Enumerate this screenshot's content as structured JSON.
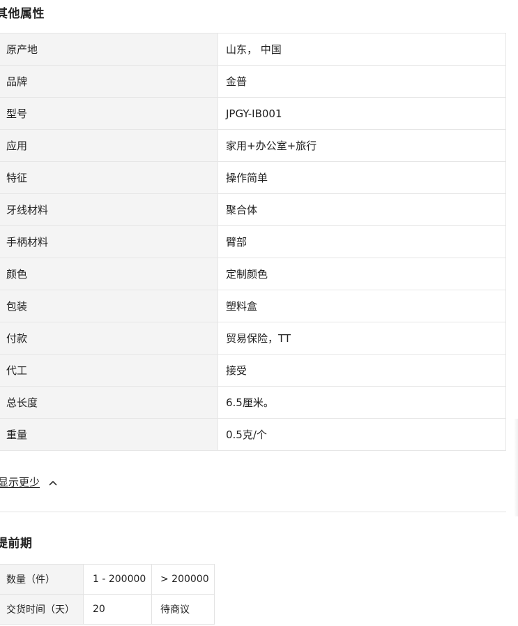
{
  "other_attributes": {
    "title": "其他属性",
    "rows": [
      {
        "key": "原产地",
        "value": "山东， 中国"
      },
      {
        "key": "品牌",
        "value": "金普"
      },
      {
        "key": "型号",
        "value": "JPGY-IB001"
      },
      {
        "key": "应用",
        "value": "家用+办公室+旅行"
      },
      {
        "key": "特征",
        "value": "操作简单"
      },
      {
        "key": "牙线材料",
        "value": "聚合体"
      },
      {
        "key": "手柄材料",
        "value": "臂部"
      },
      {
        "key": "颜色",
        "value": "定制颜色"
      },
      {
        "key": "包装",
        "value": "塑料盒"
      },
      {
        "key": "付款",
        "value": "贸易保险，TT"
      },
      {
        "key": "代工",
        "value": "接受"
      },
      {
        "key": "总长度",
        "value": "6.5厘米。"
      },
      {
        "key": "重量",
        "value": "0.5克/个"
      }
    ]
  },
  "toggle": {
    "label": "显示更少",
    "icon": "chevron-up-icon"
  },
  "lead_time": {
    "title": "提前期",
    "header_row": {
      "label": "数量（件）",
      "col1": "1 - 200000",
      "col2": "> 200000"
    },
    "data_row": {
      "label": "交货时间（天）",
      "col1": "20",
      "col2": "待商议"
    }
  }
}
